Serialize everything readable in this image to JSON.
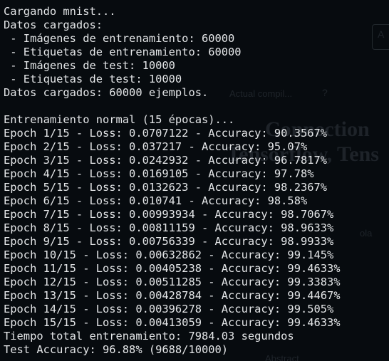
{
  "terminal": {
    "text_color": "#e4e6e8",
    "background_color": "#0b1015",
    "lines": [
      "Cargando mnist...",
      "Datos cargados:",
      " - Imágenes de entrenamiento: 60000",
      " - Etiquetas de entrenamiento: 60000",
      " - Imágenes de test: 10000",
      " - Etiquetas de test: 10000",
      "Datos cargados: 60000 ejemplos.",
      "",
      "Entrenamiento normal (15 épocas)...",
      "Epoch 1/15 - Loss: 0.0707122 - Accuracy: 90.3567%",
      "Epoch 2/15 - Loss: 0.037217 - Accuracy: 95.07%",
      "Epoch 3/15 - Loss: 0.0242932 - Accuracy: 96.7817%",
      "Epoch 4/15 - Loss: 0.0169105 - Accuracy: 97.78%",
      "Epoch 5/15 - Loss: 0.0132623 - Accuracy: 98.2367%",
      "Epoch 6/15 - Loss: 0.010741 - Accuracy: 98.58%",
      "Epoch 7/15 - Loss: 0.00993934 - Accuracy: 98.7067%",
      "Epoch 8/15 - Loss: 0.00811159 - Accuracy: 98.9633%",
      "Epoch 9/15 - Loss: 0.00756339 - Accuracy: 98.9933%",
      "Epoch 10/15 - Loss: 0.00632862 - Accuracy: 99.145%",
      "Epoch 11/15 - Loss: 0.00405238 - Accuracy: 99.4633%",
      "Epoch 12/15 - Loss: 0.00511285 - Accuracy: 99.3383%",
      "Epoch 13/15 - Loss: 0.00428784 - Accuracy: 99.4467%",
      "Epoch 14/15 - Loss: 0.00396278 - Accuracy: 99.505%",
      "Epoch 15/15 - Loss: 0.00413059 - Accuracy: 99.4633%",
      "Tiempo total entrenamiento: 7984.03 segundos",
      "Test Accuracy: 96.88% (9688/10000)"
    ]
  },
  "background_page": {
    "text_color": "#5a646e",
    "fragments": {
      "box_letter": "A",
      "link_text": "Actual compil...",
      "help_icon_glyph": "?",
      "title_fragment_1": "Connection",
      "title_fragment_2": "Tensorflow, Tens",
      "small_fragment_1": "ola",
      "small_fragment_2": "Abstract"
    }
  }
}
